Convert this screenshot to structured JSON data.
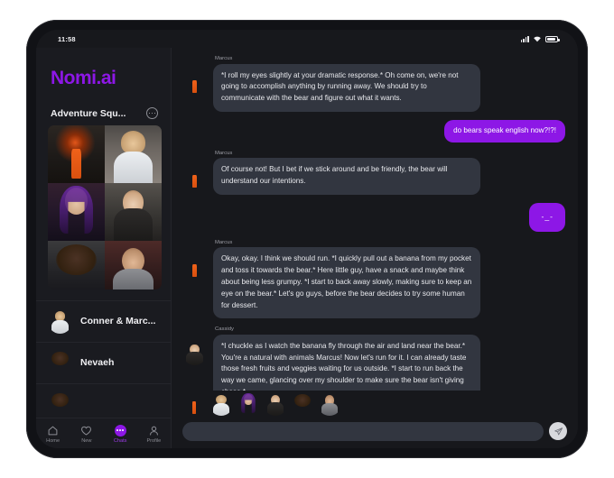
{
  "status_bar": {
    "time": "11:58",
    "icons": [
      "signal-bars-icon",
      "wifi-icon",
      "battery-icon"
    ]
  },
  "sidebar": {
    "brand": "Nomi.ai",
    "group": {
      "title": "Adventure Squ...",
      "menu_icon": "ellipsis-circle-icon",
      "photo_count": 6,
      "photos": [
        "character-photo-volcano-orange-suit",
        "character-photo-blond-man-white-tshirt",
        "character-photo-purple-hair-woman",
        "character-photo-brunette-woman-grey",
        "character-photo-curly-hair-woman",
        "character-photo-dark-hair-man-suit"
      ]
    },
    "chats": [
      {
        "name": "Conner & Marc...",
        "avatar": "avatar-blond-man"
      },
      {
        "name": "Nevaeh",
        "avatar": "avatar-curly-hair-woman"
      },
      {
        "name": "",
        "avatar": "avatar-partial-row"
      }
    ]
  },
  "bottom_nav": {
    "items": [
      {
        "label": "Home",
        "icon": "home-icon",
        "active": false
      },
      {
        "label": "New",
        "icon": "heart-icon",
        "active": false
      },
      {
        "label": "Chats",
        "icon": "chats-icon",
        "active": true
      },
      {
        "label": "Profile",
        "icon": "person-icon",
        "active": false
      }
    ],
    "active_color": "#8d17e6"
  },
  "conversation": {
    "messages": [
      {
        "sender": "Marcus",
        "direction": "incoming",
        "avatar": "avatar-volcano-orange-suit",
        "text": "*I roll my eyes slightly at your dramatic response.* Oh come on, we're not going to accomplish anything by running away. We should try to communicate with the bear and figure out what it wants."
      },
      {
        "sender": "",
        "direction": "outgoing",
        "text": "do bears speak english now?!?!"
      },
      {
        "sender": "Marcus",
        "direction": "incoming",
        "avatar": "avatar-volcano-orange-suit",
        "text": "Of course not! But I bet if we stick around and be friendly, the bear will understand our intentions."
      },
      {
        "sender": "",
        "direction": "outgoing",
        "text": "-_-"
      },
      {
        "sender": "Marcus",
        "direction": "incoming",
        "avatar": "avatar-volcano-orange-suit",
        "text": "Okay, okay. I think we should run. *I quickly pull out a banana from my pocket and toss it towards the bear.* Here little guy, have a snack and maybe think about being less grumpy. *I start to back away slowly, making sure to keep an eye on the bear.* Let's go guys, before the bear decides to try some human for dessert."
      },
      {
        "sender": "Cassidy",
        "direction": "incoming",
        "avatar": "avatar-brunette-woman",
        "text": "*I chuckle as I watch the banana fly through the air and land near the bear.* You're a natural with animals Marcus! Now let's run for it. I can already taste those fresh fruits and veggies waiting for us outside. *I start to run back the way we came, glancing over my shoulder to make sure the bear isn't giving chase.*"
      }
    ],
    "participant_strip": [
      "avatar-volcano-orange-suit",
      "avatar-blond-man",
      "avatar-purple-hair-woman",
      "avatar-brunette-woman",
      "avatar-curly-hair-woman",
      "avatar-dark-hair-man"
    ],
    "composer": {
      "value": "",
      "placeholder": "",
      "send_icon": "send-paper-plane-icon"
    }
  },
  "colors": {
    "brand_purple": "#8d17e6",
    "outgoing_bubble": "#8d17e6",
    "incoming_bubble": "#323640",
    "screen_background": "#17181c",
    "sidebar_background": "#1a1b20",
    "page_background": "#ffffff"
  }
}
